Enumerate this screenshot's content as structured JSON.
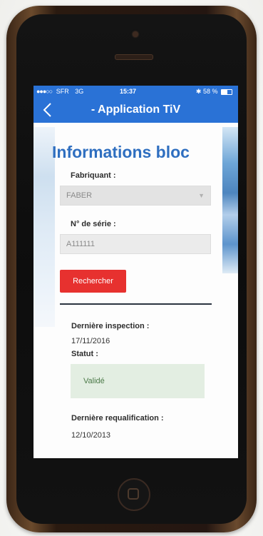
{
  "status_bar": {
    "carrier": "SFR",
    "network": "3G",
    "time": "15:37",
    "battery": "58 %",
    "battery_fraction": 0.58
  },
  "nav": {
    "title": "- Application TiV",
    "back_icon": "chevron-left-icon"
  },
  "form": {
    "page_title": "Informations bloc",
    "manufacturer_label": "Fabriquant :",
    "manufacturer_value": "FABER",
    "serial_label": "N° de série :",
    "serial_value": "A111111",
    "search_button": "Rechercher"
  },
  "results": {
    "last_inspection_label": "Dernière inspection :",
    "last_inspection_value": "17/11/2016",
    "status_label": "Statut :",
    "status_value": "Validé",
    "last_requalification_label": "Dernière requalification :",
    "last_requalification_value": "12/10/2013"
  },
  "colors": {
    "brand_blue": "#2a72d6",
    "title_blue": "#2f6fc0",
    "button_red": "#e7312f",
    "status_green_bg": "#e3eee2"
  }
}
